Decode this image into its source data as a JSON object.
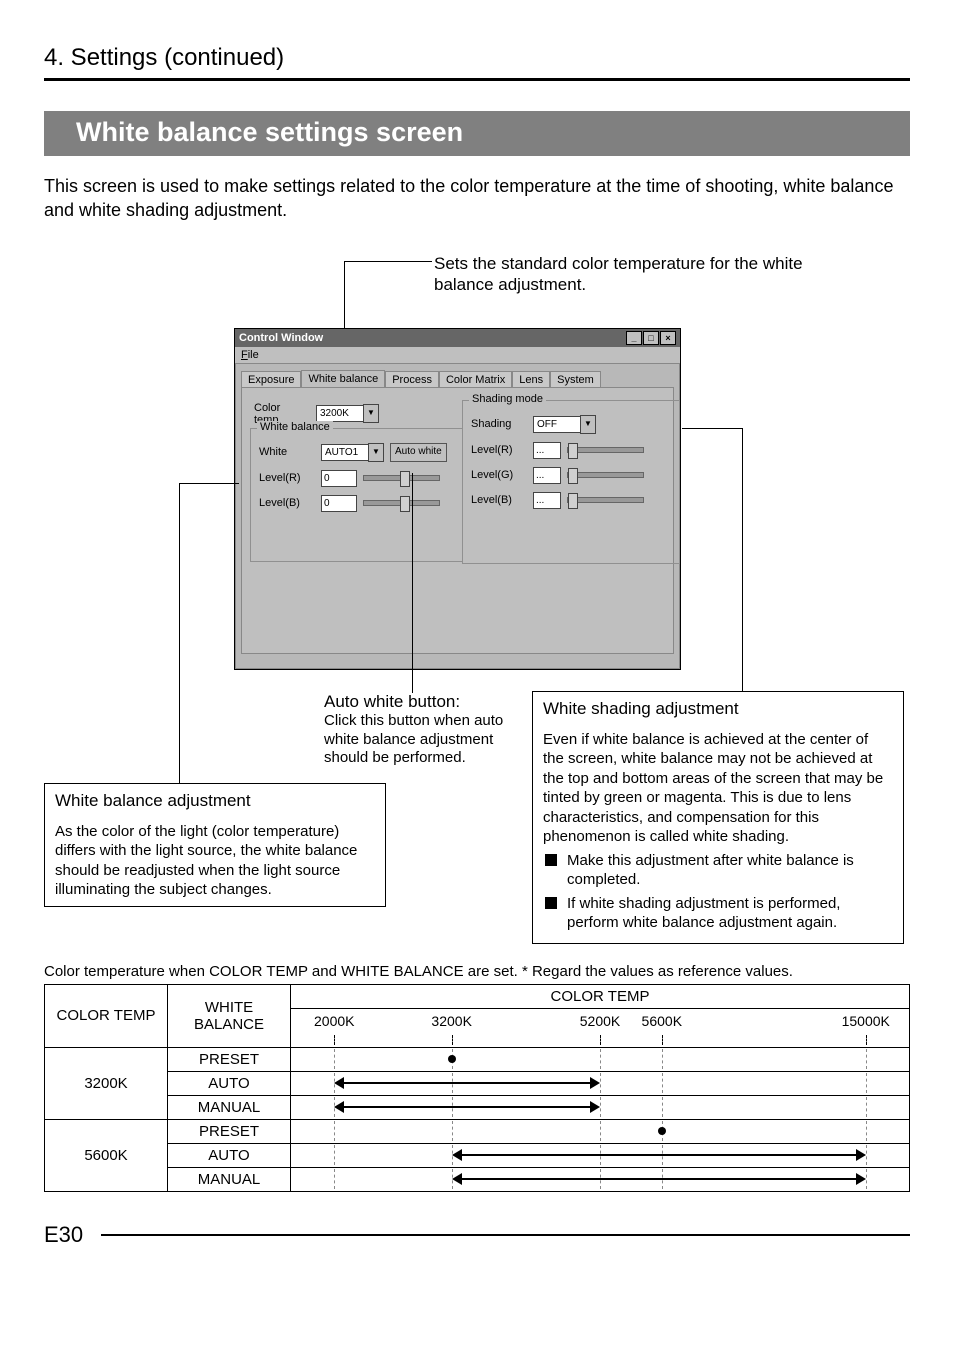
{
  "page": {
    "heading": "4. Settings (continued)",
    "section": "White balance settings screen",
    "intro": "This screen is used to make settings related to the color temperature at the time of shooting, white balance and white shading adjustment.",
    "footer_page": "E30"
  },
  "callouts": {
    "top": "Sets the standard color temperature for the white balance adjustment.",
    "auto_white": {
      "title": "Auto white button:",
      "body": "Click this button when auto white balance adjustment should be performed."
    },
    "wb_adjust": {
      "title": "White balance adjustment",
      "body": "As the color of the light (color temperature) differs with the light source, the white balance should be readjusted when the light source illuminating the subject changes."
    },
    "shading": {
      "title": "White shading adjustment",
      "body": "Even if white balance is achieved at the center of the screen, white balance may not be achieved at the top and bottom areas of the screen that may be tinted by green or magenta. This is due to lens characteristics, and compensation for this phenomenon is called white shading.",
      "bullets": [
        "Make this adjustment after white balance is completed.",
        "If white shading adjustment is performed, perform white balance adjustment again."
      ]
    }
  },
  "window": {
    "title": "Control Window",
    "menu_file": "File",
    "tabs": [
      "Exposure",
      "White balance",
      "Process",
      "Color Matrix",
      "Lens",
      "System"
    ],
    "active_tab_index": 1,
    "left_panel": {
      "color_temp_label": "Color temp.",
      "color_temp_value": "3200K",
      "fieldset": "White balance",
      "white_label": "White",
      "white_value": "AUTO1",
      "auto_white_btn": "Auto white",
      "level_r_label": "Level(R)",
      "level_r_value": "0",
      "level_b_label": "Level(B)",
      "level_b_value": "0"
    },
    "right_panel": {
      "fieldset": "Shading mode",
      "shading_label": "Shading",
      "shading_value": "OFF",
      "level_r_label": "Level(R)",
      "level_r_value": "...",
      "level_g_label": "Level(G)",
      "level_g_value": "...",
      "level_b_label": "Level(B)",
      "level_b_value": "..."
    }
  },
  "table": {
    "note": "Color temperature when COLOR TEMP and WHITE BALANCE are set. * Regard the values as reference values.",
    "col_headers": {
      "c1": "COLOR TEMP",
      "c2": "WHITE BALANCE",
      "c3": "COLOR TEMP"
    },
    "ticks": [
      "2000K",
      "3200K",
      "5200K",
      "5600K",
      "15000K"
    ],
    "groups": [
      {
        "ct": "3200K",
        "rows": [
          "PRESET",
          "AUTO",
          "MANUAL"
        ]
      },
      {
        "ct": "5600K",
        "rows": [
          "PRESET",
          "AUTO",
          "MANUAL"
        ]
      }
    ]
  },
  "chart_data": {
    "type": "table",
    "title": "Color temperature when COLOR TEMP and WHITE BALANCE are set",
    "note": "Regard the values as reference values.",
    "x_axis_k": [
      2000,
      3200,
      5200,
      5600,
      15000
    ],
    "rows": [
      {
        "color_temp_setting": "3200K",
        "white_balance": "PRESET",
        "point_k": 3200
      },
      {
        "color_temp_setting": "3200K",
        "white_balance": "AUTO",
        "range_k": [
          2000,
          5200
        ]
      },
      {
        "color_temp_setting": "3200K",
        "white_balance": "MANUAL",
        "range_k": [
          2000,
          5200
        ]
      },
      {
        "color_temp_setting": "5600K",
        "white_balance": "PRESET",
        "point_k": 5600
      },
      {
        "color_temp_setting": "5600K",
        "white_balance": "AUTO",
        "range_k": [
          3200,
          15000
        ]
      },
      {
        "color_temp_setting": "5600K",
        "white_balance": "MANUAL",
        "range_k": [
          3200,
          15000
        ]
      }
    ]
  }
}
